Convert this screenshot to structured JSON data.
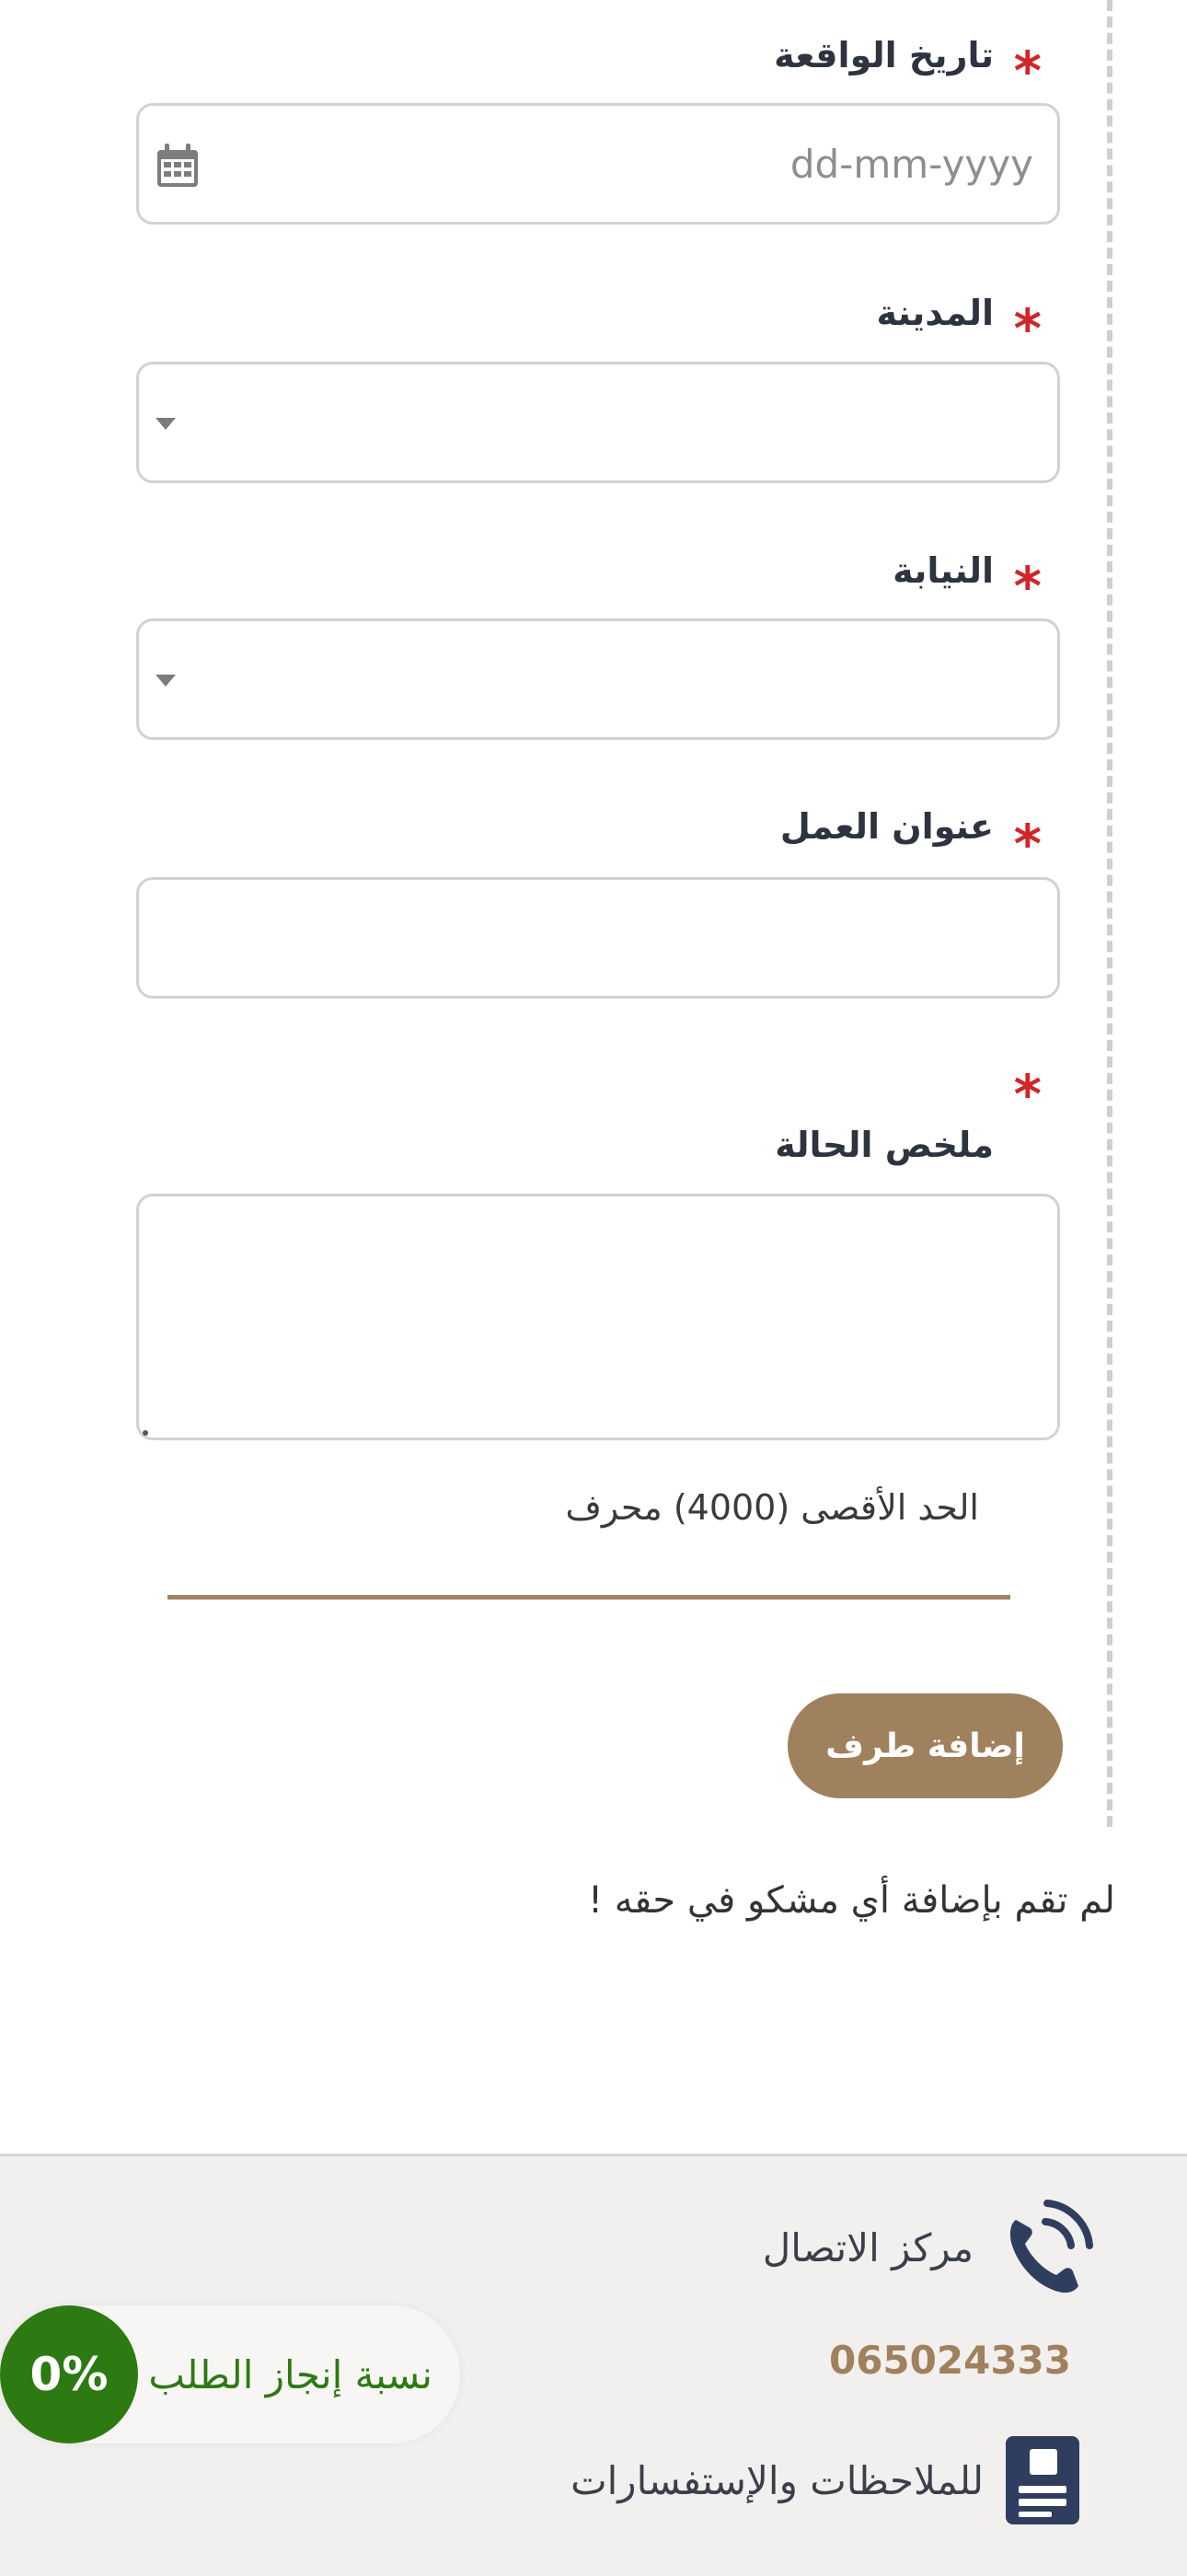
{
  "form": {
    "incident_date": {
      "label": "تاريخ الواقعة",
      "required_mark": "*",
      "placeholder": "dd-mm-yyyy",
      "value": ""
    },
    "city": {
      "label": "المدينة",
      "required_mark": "*",
      "selected": ""
    },
    "prosecution": {
      "label": "النيابة",
      "required_mark": "*",
      "selected": ""
    },
    "work_address": {
      "label": "عنوان العمل",
      "required_mark": "*",
      "value": ""
    },
    "case_summary": {
      "label": "ملخص الحالة",
      "required_mark": "*",
      "value": "",
      "max_chars_note": "الحد الأقصى (4000) محرف"
    },
    "add_party_button": "إضافة طرف",
    "no_party_message": "لم تقم بإضافة أي مشكو في حقه !"
  },
  "footer": {
    "contact_center_label": "مركز الاتصال",
    "contact_center_phone": "065024333",
    "feedback_label": "للملاحظات والإستفسارات",
    "contact_icon": "phone-icon",
    "feedback_icon": "document-icon"
  },
  "progress": {
    "label": "نسبة إنجاز الطلب",
    "value_text": "0%",
    "percent": 0
  },
  "colors": {
    "accent": "#a0815d",
    "required": "#d0262a",
    "progress": "#2d7a13",
    "footer_bg": "#f2f0ee"
  }
}
